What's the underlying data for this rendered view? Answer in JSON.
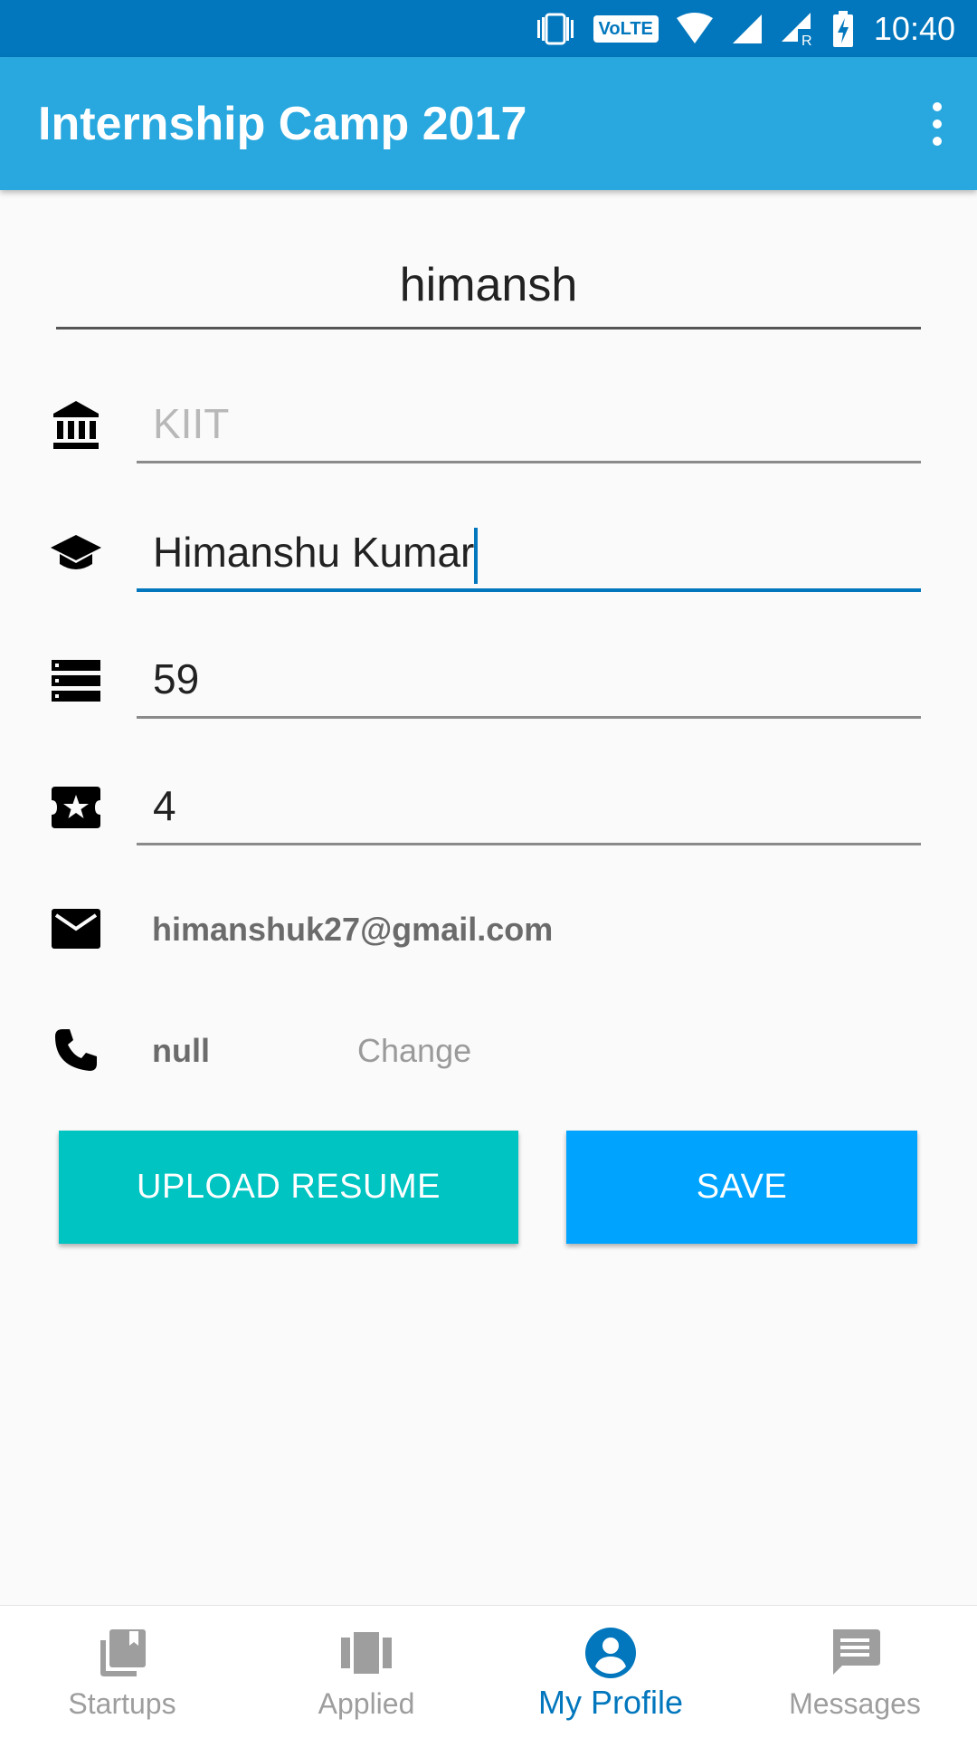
{
  "status_bar": {
    "volte": "VoLTE",
    "network_r": "R",
    "time": "10:40"
  },
  "app_bar": {
    "title": "Internship Camp 2017",
    "menu_icon": "more-vert-icon"
  },
  "profile": {
    "name": "himansh",
    "college_placeholder": "KIIT",
    "course_value": "Himanshu Kumar",
    "score_value": "59",
    "rating_value": "4",
    "email": "himanshuk27@gmail.com",
    "phone": "null",
    "change_label": "Change"
  },
  "icons": {
    "college": "bank-icon",
    "course": "graduation-cap-icon",
    "score": "list-icon",
    "rating": "star-ticket-icon",
    "email": "mail-icon",
    "phone": "phone-icon"
  },
  "actions": {
    "upload_label": "UPLOAD RESUME",
    "save_label": "SAVE"
  },
  "bottom_nav": {
    "items": [
      {
        "label": "Startups",
        "icon": "library-books-icon"
      },
      {
        "label": "Applied",
        "icon": "view-carousel-icon"
      },
      {
        "label": "My Profile",
        "icon": "account-circle-icon"
      },
      {
        "label": "Messages",
        "icon": "message-icon"
      }
    ],
    "active_index": 2
  },
  "colors": {
    "status_bar": "#0277bd",
    "app_bar": "#29a8df",
    "upload_button": "#00c4c2",
    "save_button": "#00a4ff",
    "active_nav": "#0277bd"
  }
}
